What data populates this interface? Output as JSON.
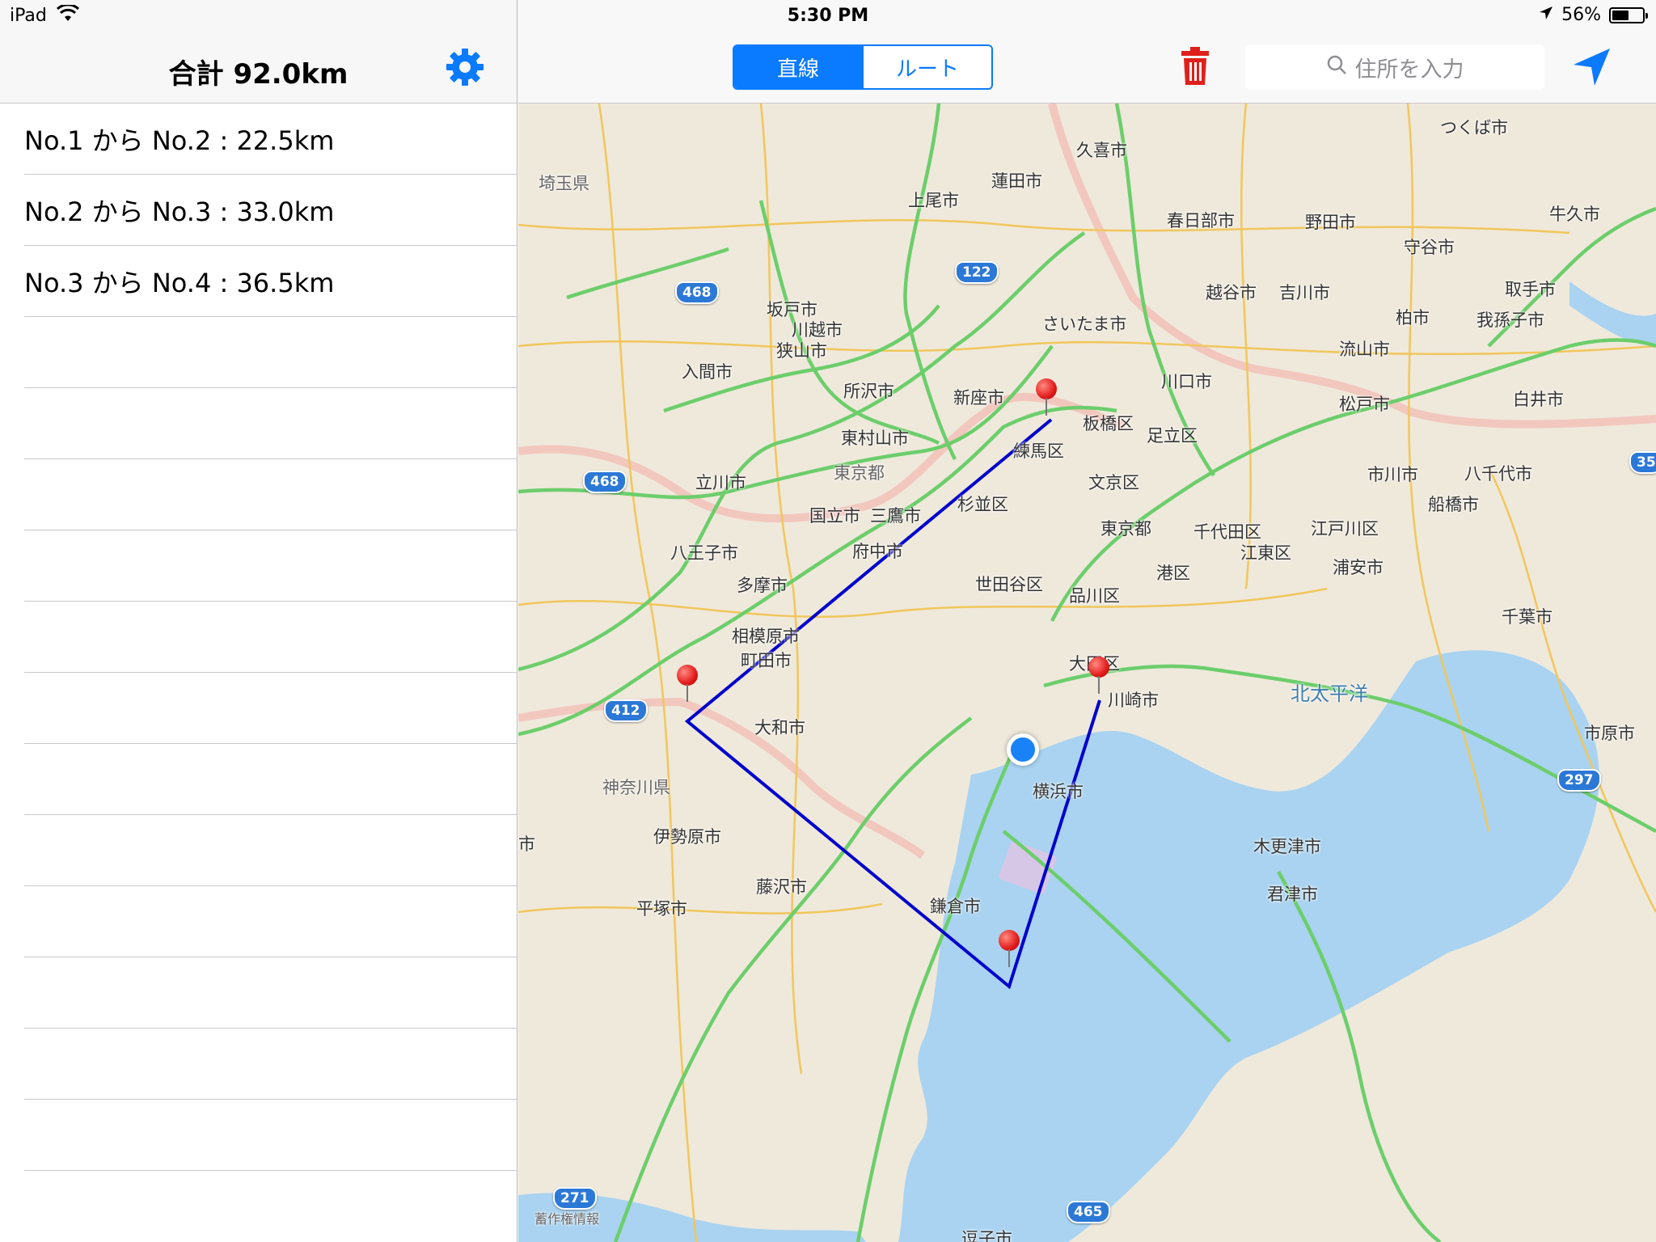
{
  "status_bar": {
    "device": "iPad",
    "time": "5:30 PM",
    "battery": "56%",
    "battery_level": 0.56,
    "icons": [
      "wifi-icon",
      "location-arrow-icon",
      "battery-icon"
    ]
  },
  "left_panel": {
    "title": "合計 92.0km",
    "settings_icon": "gear-icon",
    "segments": [
      "No.1 から No.2 : 22.5km",
      "No.2 から No.3 : 33.0km",
      "No.3 から No.4 : 36.5km"
    ],
    "empty_rows": 12
  },
  "toolbar": {
    "mode_straight": "直線",
    "mode_route": "ルート",
    "active_mode": "直線",
    "delete_icon": "trash-icon",
    "search_icon": "magnifier-icon",
    "search_placeholder": "住所を入力",
    "locate_icon": "location-arrow-icon"
  },
  "map": {
    "colors": {
      "land": "#efe9dc",
      "water": "#a9d3f0",
      "highway": "#6cce6b",
      "road": "#f1c75b",
      "measure_line": "#0000cc",
      "pin": "#e21b1b",
      "user": "#1a82f7",
      "accent": "#0a7aff",
      "trash": "#e0201b"
    },
    "labels": [
      "久喜市",
      "つくば市",
      "埼玉県",
      "蓮田市",
      "上尾市",
      "春日部市",
      "野田市",
      "牛久市",
      "坂戸市",
      "川越市",
      "守谷市",
      "越谷市",
      "吉川市",
      "取手市",
      "柏市",
      "我孫子市",
      "さいたま市",
      "狭山市",
      "入間市",
      "流山市",
      "川口市",
      "所沢市",
      "新座市",
      "松戸市",
      "白井市",
      "板橋区",
      "足立区",
      "東村山市",
      "練馬区",
      "東京都",
      "立川市",
      "文京区",
      "市川市",
      "八千代市",
      "船橋市",
      "杉並区",
      "国立市",
      "三鷹市",
      "東京都",
      "千代田区",
      "江戸川区",
      "八王子市",
      "府中市",
      "江東区",
      "浦安市",
      "港区",
      "多摩市",
      "世田谷区",
      "品川区",
      "千葉市",
      "相模原市",
      "町田市",
      "大田区",
      "北太平洋",
      "川崎市",
      "大和市",
      "市原市",
      "神奈川県",
      "横浜市",
      "伊勢原市",
      "木更津市",
      "藤沢市",
      "平塚市",
      "鎌倉市",
      "君津市",
      "逗子市",
      "蓄作権情報",
      "市"
    ],
    "shields": [
      "122",
      "468",
      "468",
      "412",
      "297",
      "271",
      "465",
      "35"
    ]
  }
}
